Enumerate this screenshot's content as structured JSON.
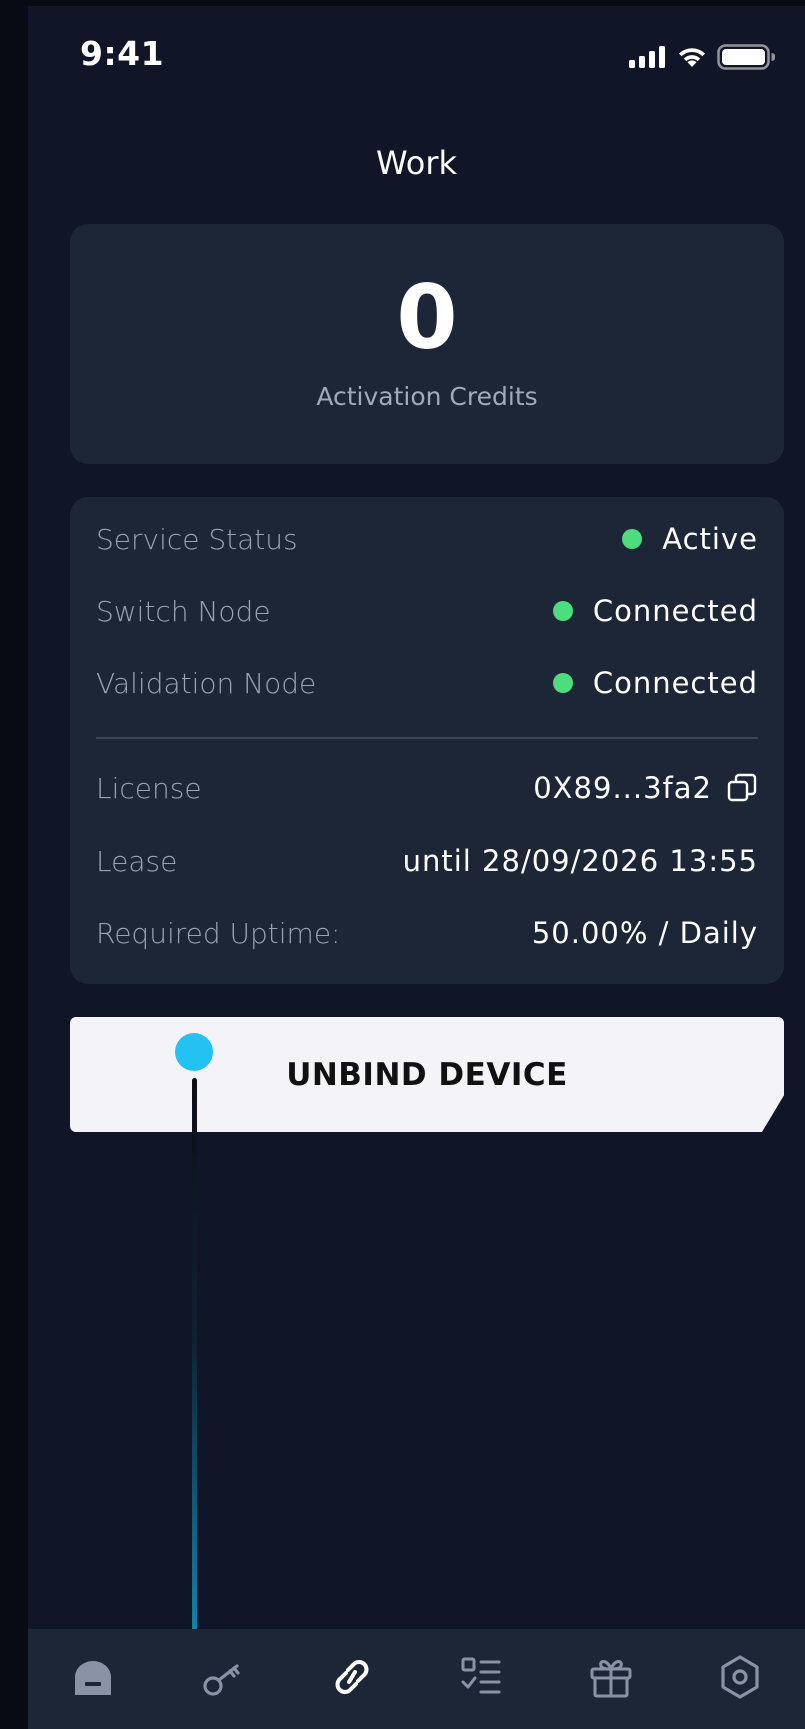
{
  "status_bar": {
    "time": "9:41"
  },
  "header": {
    "title": "Work"
  },
  "credits": {
    "value": "0",
    "label": "Activation Credits"
  },
  "info": {
    "service_status": {
      "label": "Service Status",
      "value": "Active",
      "color": "#4ddc7e"
    },
    "switch_node": {
      "label": "Switch Node",
      "value": "Connected",
      "color": "#4ddc7e"
    },
    "validation_node": {
      "label": "Validation Node",
      "value": "Connected",
      "color": "#4ddc7e"
    },
    "license": {
      "label": "License",
      "value": "0X89...3fa2",
      "icon": "copy-icon"
    },
    "lease": {
      "label": "Lease",
      "value": "until 28/09/2026 13:55"
    },
    "uptime": {
      "label": "Required Uptime:",
      "value": "50.00% / Daily"
    }
  },
  "actions": {
    "unbind_label": "UNBIND DEVICE"
  },
  "tab_bar": {
    "items": [
      {
        "icon": "home-icon",
        "active": false
      },
      {
        "icon": "key-icon",
        "active": false
      },
      {
        "icon": "link-icon",
        "active": true
      },
      {
        "icon": "tasks-icon",
        "active": false
      },
      {
        "icon": "gift-icon",
        "active": false
      },
      {
        "icon": "settings-hexagon-icon",
        "active": false
      }
    ]
  },
  "colors": {
    "background": "#101628",
    "card": "#1d2637",
    "accent_pointer": "#23c2f2",
    "status_ok": "#4ddc7e"
  }
}
